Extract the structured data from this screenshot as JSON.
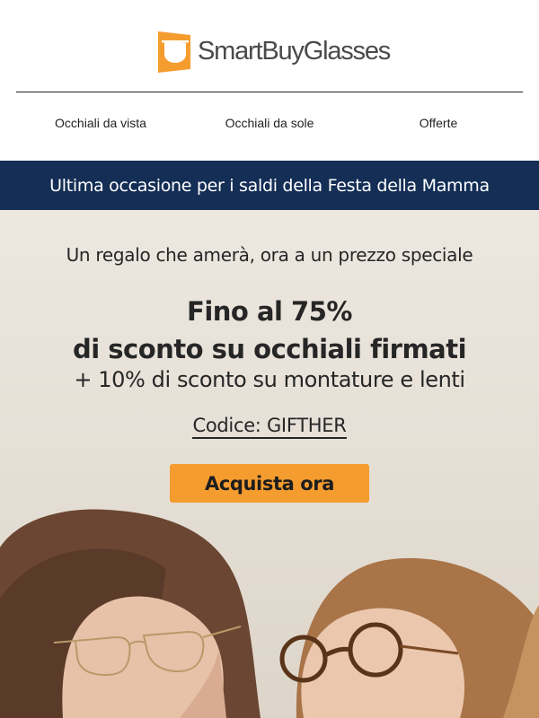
{
  "header": {
    "logo_text": "SmartBuyGlasses",
    "brand_color": "#f59c2f"
  },
  "nav": {
    "items": [
      {
        "label": "Occhiali da vista"
      },
      {
        "label": "Occhiali da sole"
      },
      {
        "label": "Offerte"
      }
    ]
  },
  "banner": {
    "text": "Ultima occasione per i saldi della Festa della Mamma",
    "background": "#142e55"
  },
  "hero": {
    "subtitle": "Un regalo che amerà, ora a un prezzo speciale",
    "headline_line1": "Fino al 75%",
    "headline_line2": "di sconto su occhiali firmati",
    "extra_discount": "+ 10% di sconto su montature e lenti",
    "promo_code": "Codice: GIFTHER",
    "cta_label": "Acquista ora",
    "cta_color": "#f59c2f"
  }
}
